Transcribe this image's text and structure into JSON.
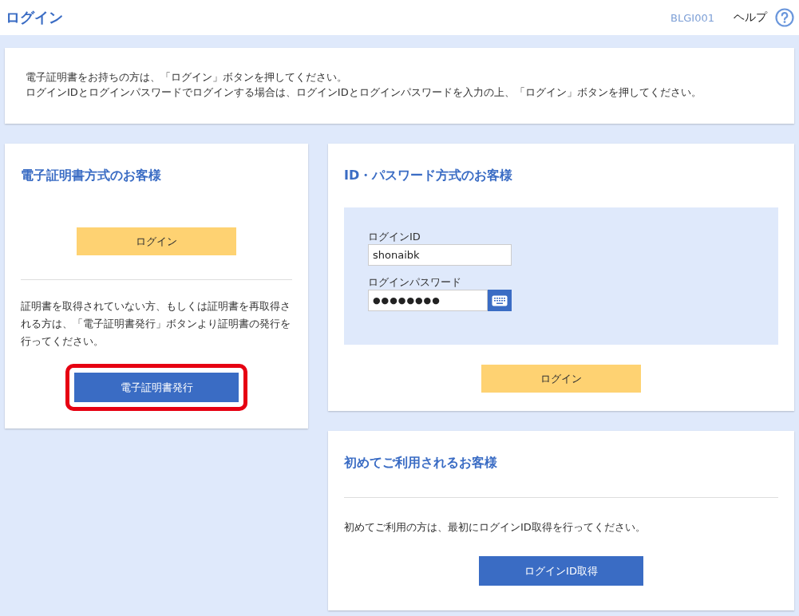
{
  "header": {
    "title": "ログイン",
    "screen_id": "BLGI001",
    "help_label": "ヘルプ"
  },
  "notice": {
    "lines": [
      "電子証明書をお持ちの方は、「ログイン」ボタンを押してください。",
      "ログインIDとログインパスワードでログインする場合は、ログインIDとログインパスワードを入力の上、「ログイン」ボタンを押してください。"
    ]
  },
  "certificate_card": {
    "heading": "電子証明書方式のお客様",
    "login_button": "ログイン",
    "description": "証明書を取得されていない方、もしくは証明書を再取得される方は、「電子証明書発行」ボタンより証明書の発行を行ってください。",
    "issue_button": {
      "label": "電子証明書発行",
      "highlighted": true
    }
  },
  "password_card": {
    "heading": "ID・パスワード方式のお客様",
    "fields": [
      {
        "label": "ログインID",
        "value": "shonaibk",
        "kind": "text"
      },
      {
        "label": "ログインパスワード",
        "value": "●●●●●●●●",
        "kind": "password"
      }
    ],
    "login_button": "ログイン"
  },
  "first_time_card": {
    "heading": "初めてご利用されるお客様",
    "description": "初めてご利用の方は、最初にログインID取得を行ってください。",
    "button": "ログインID取得"
  }
}
